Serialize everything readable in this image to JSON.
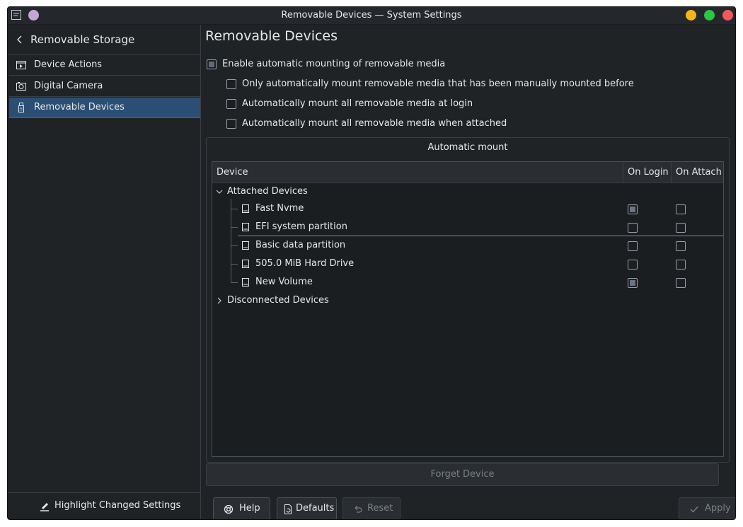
{
  "window": {
    "title": "Removable Devices — System Settings"
  },
  "sidebar": {
    "header": "Removable Storage",
    "items": [
      {
        "label": "Device Actions",
        "icon": "device-actions-icon"
      },
      {
        "label": "Digital Camera",
        "icon": "camera-icon"
      },
      {
        "label": "Removable Devices",
        "icon": "usb-icon",
        "selected": true
      }
    ],
    "footer": "Highlight Changed Settings"
  },
  "page": {
    "title": "Removable Devices",
    "enable_auto_mount": {
      "label": "Enable automatic mounting of removable media",
      "state": "partial"
    },
    "options": [
      {
        "label": "Only automatically mount removable media that has been manually mounted before",
        "checked": false
      },
      {
        "label": "Automatically mount all removable media at login",
        "checked": false
      },
      {
        "label": "Automatically mount all removable media when attached",
        "checked": false
      }
    ]
  },
  "automount": {
    "group_title": "Automatic mount",
    "columns": [
      "Device",
      "On Login",
      "On Attach"
    ],
    "attached_label": "Attached Devices",
    "disconnected_label": "Disconnected Devices",
    "devices": [
      {
        "name": "Fast Nvme",
        "on_login": true,
        "on_attach": false
      },
      {
        "name": "EFI system partition",
        "on_login": false,
        "on_attach": false
      },
      {
        "name": "Basic data partition",
        "on_login": false,
        "on_attach": false
      },
      {
        "name": "505.0 MiB Hard Drive",
        "on_login": false,
        "on_attach": false
      },
      {
        "name": "New Volume",
        "on_login": true,
        "on_attach": false
      }
    ],
    "forget_label": "Forget Device"
  },
  "buttons": {
    "help": "Help",
    "defaults": "Defaults",
    "reset": "Reset",
    "apply": "Apply"
  },
  "colors": {
    "background": "#202326",
    "selection": "#2b4f74",
    "text": "#e6e8ea",
    "disabled_text": "#7b8085"
  }
}
